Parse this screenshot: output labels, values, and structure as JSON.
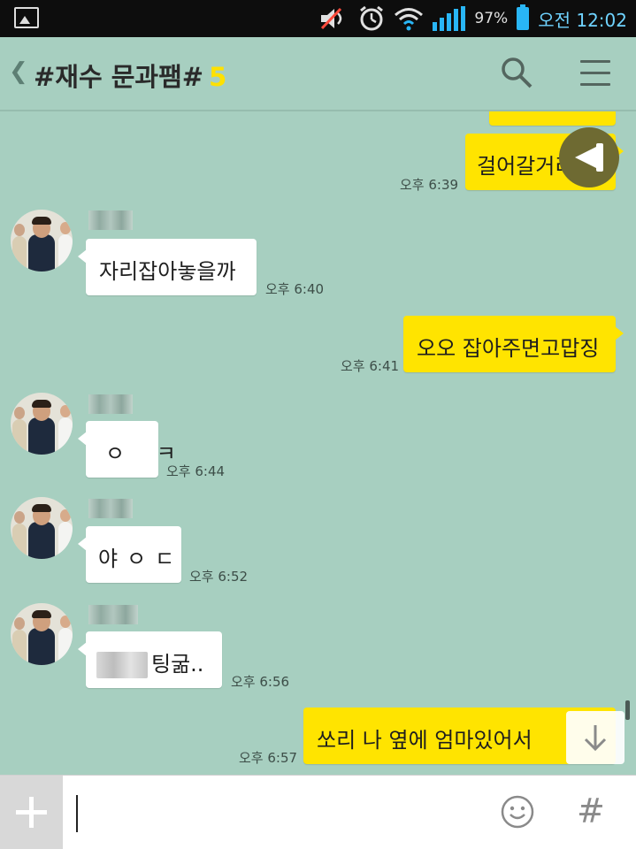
{
  "status_bar": {
    "battery_percent": "97%",
    "time": "오전 12:02",
    "icons": [
      "image-icon",
      "mute-icon",
      "alarm-icon",
      "wifi-icon",
      "signal-icon",
      "battery-icon"
    ]
  },
  "header": {
    "title": "#재수 문과팸#",
    "member_count": "5",
    "icons": [
      "back-icon",
      "search-icon",
      "menu-icon"
    ]
  },
  "messages": [
    {
      "sender": "me",
      "text": "걸어갈거리",
      "time": "오후 6:39",
      "partial": true
    },
    {
      "sender": "other",
      "text": "자리잡아놓을까",
      "time": "오후 6:40"
    },
    {
      "sender": "me",
      "text": "오오 잡아주면고맙징",
      "time": "오후 6:41"
    },
    {
      "sender": "other",
      "text": "ㅇ ㅋ",
      "time": "오후 6:44"
    },
    {
      "sender": "other",
      "text": "야ㅇㄷ",
      "time": "오후 6:52"
    },
    {
      "sender": "other",
      "text": "팅굶..",
      "time": "오후 6:56",
      "blurred_prefix": true
    },
    {
      "sender": "me",
      "text": "쏘리 나 옆에 엄마있어서",
      "time": "오후 6:57"
    }
  ],
  "input": {
    "icons": [
      "plus-icon",
      "emoji-icon",
      "hashtag-icon"
    ],
    "hashtag": "#",
    "value": ""
  },
  "colors": {
    "background": "#a7cfc0",
    "my_bubble": "#ffe400",
    "other_bubble": "#ffffff",
    "accent_count": "#ffe100"
  }
}
